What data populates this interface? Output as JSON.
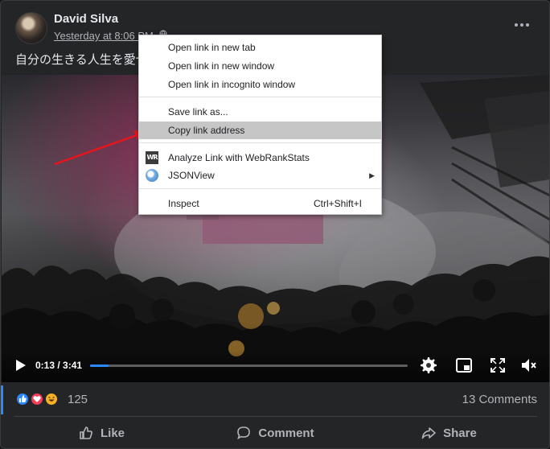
{
  "post": {
    "author": "David Silva",
    "timestamp": "Yesterday at 8:06 PM",
    "caption": "自分の生きる人生を愛せ"
  },
  "video": {
    "current_time": "0:13",
    "duration": "3:41",
    "time_display": "0:13 / 3:41",
    "progress": 0.059
  },
  "reactions": {
    "types": [
      "like",
      "love",
      "haha"
    ],
    "count": "125",
    "comments": "13 Comments"
  },
  "actions": {
    "like": "Like",
    "comment": "Comment",
    "share": "Share"
  },
  "context_menu": {
    "open_new_tab": "Open link in new tab",
    "open_new_window": "Open link in new window",
    "open_incognito": "Open link in incognito window",
    "save_link_as": "Save link as...",
    "copy_link_address": "Copy link address",
    "analyze_link": "Analyze Link with WebRankStats",
    "analyze_icon_text": "WR",
    "jsonview": "JSONView",
    "inspect": "Inspect",
    "inspect_shortcut": "Ctrl+Shift+I",
    "highlighted_item": "Copy link address"
  },
  "colors": {
    "accent": "#2d88ff",
    "arrow": "#e8141b",
    "card_bg": "#242526",
    "menu_highlight": "#c6c6c6"
  },
  "icons": [
    "more-icon",
    "globe-icon",
    "play-icon",
    "settings-icon",
    "picture-in-picture-icon",
    "fullscreen-icon",
    "mute-icon",
    "like-icon",
    "comment-icon",
    "share-icon",
    "webrankstats-icon",
    "jsonview-icon",
    "chevron-right-icon"
  ]
}
